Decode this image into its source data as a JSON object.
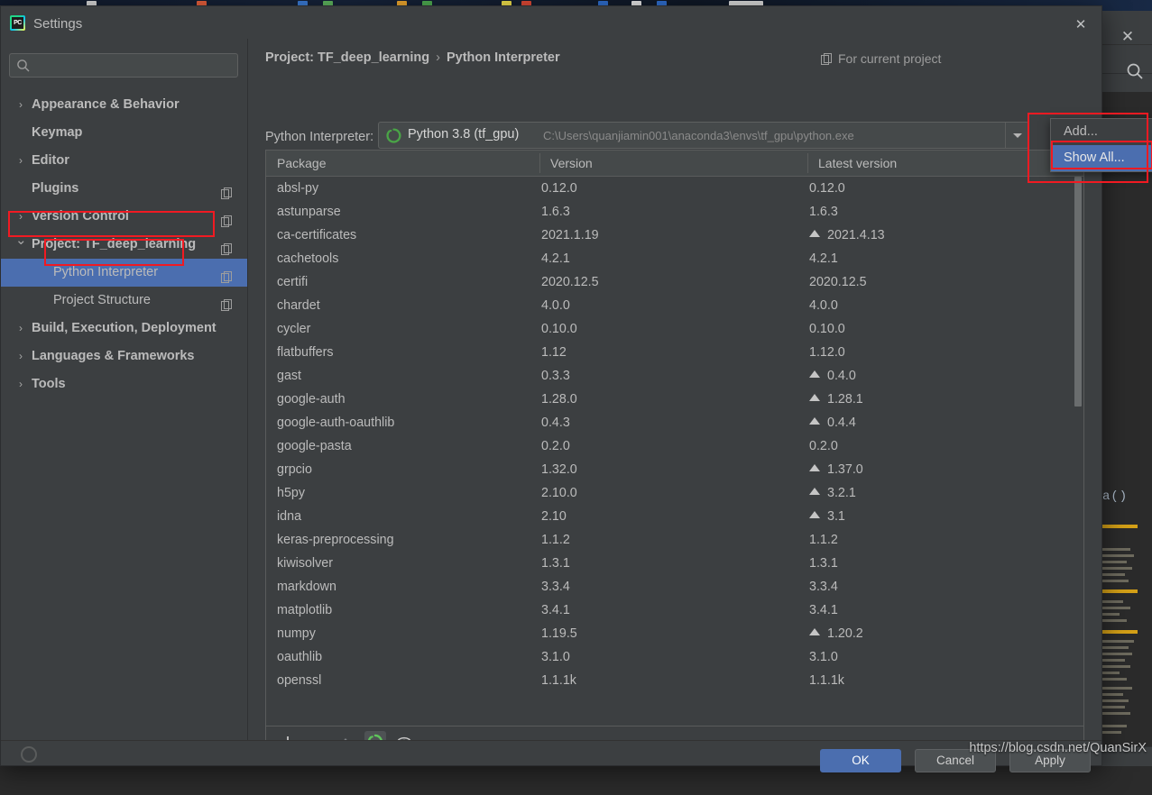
{
  "dialog": {
    "title": "Settings",
    "logo_text": "PC",
    "close_icon": "✕"
  },
  "search": {
    "value": "",
    "placeholder": "",
    "icon": "search-icon"
  },
  "sidebar": {
    "items": [
      {
        "label": "Appearance & Behavior",
        "level": 0,
        "twisty": "›",
        "copy": false,
        "selected": false
      },
      {
        "label": "Keymap",
        "level": 0,
        "twisty": "",
        "copy": false,
        "selected": false
      },
      {
        "label": "Editor",
        "level": 0,
        "twisty": "›",
        "copy": false,
        "selected": false
      },
      {
        "label": "Plugins",
        "level": 0,
        "twisty": "",
        "copy": true,
        "selected": false
      },
      {
        "label": "Version Control",
        "level": 0,
        "twisty": "›",
        "copy": true,
        "selected": false
      },
      {
        "label": "Project: TF_deep_learning",
        "level": 0,
        "twisty": "⌄",
        "copy": true,
        "selected": false
      },
      {
        "label": "Python Interpreter",
        "level": 1,
        "twisty": "",
        "copy": true,
        "selected": true
      },
      {
        "label": "Project Structure",
        "level": 1,
        "twisty": "",
        "copy": true,
        "selected": false
      },
      {
        "label": "Build, Execution, Deployment",
        "level": 0,
        "twisty": "›",
        "copy": false,
        "selected": false
      },
      {
        "label": "Languages & Frameworks",
        "level": 0,
        "twisty": "›",
        "copy": false,
        "selected": false
      },
      {
        "label": "Tools",
        "level": 0,
        "twisty": "›",
        "copy": false,
        "selected": false
      }
    ]
  },
  "content": {
    "breadcrumb_project": "Project: TF_deep_learning",
    "breadcrumb_separator": "›",
    "breadcrumb_page": "Python Interpreter",
    "for_current_project": "For current project",
    "interpreter_label": "Python Interpreter:",
    "interpreter_name": "Python 3.8 (tf_gpu)",
    "interpreter_path": "C:\\Users\\quanjiamin001\\anaconda3\\envs\\tf_gpu\\python.exe"
  },
  "popup": {
    "items": [
      {
        "label": "Add...",
        "highlighted": false
      },
      {
        "label": "Show All...",
        "highlighted": true
      }
    ]
  },
  "table": {
    "columns": [
      "Package",
      "Version",
      "Latest version"
    ],
    "rows": [
      {
        "package": "absl-py",
        "version": "0.12.0",
        "latest": "0.12.0",
        "upgradable": false
      },
      {
        "package": "astunparse",
        "version": "1.6.3",
        "latest": "1.6.3",
        "upgradable": false
      },
      {
        "package": "ca-certificates",
        "version": "2021.1.19",
        "latest": "2021.4.13",
        "upgradable": true
      },
      {
        "package": "cachetools",
        "version": "4.2.1",
        "latest": "4.2.1",
        "upgradable": false
      },
      {
        "package": "certifi",
        "version": "2020.12.5",
        "latest": "2020.12.5",
        "upgradable": false
      },
      {
        "package": "chardet",
        "version": "4.0.0",
        "latest": "4.0.0",
        "upgradable": false
      },
      {
        "package": "cycler",
        "version": "0.10.0",
        "latest": "0.10.0",
        "upgradable": false
      },
      {
        "package": "flatbuffers",
        "version": "1.12",
        "latest": "1.12.0",
        "upgradable": false
      },
      {
        "package": "gast",
        "version": "0.3.3",
        "latest": "0.4.0",
        "upgradable": true
      },
      {
        "package": "google-auth",
        "version": "1.28.0",
        "latest": "1.28.1",
        "upgradable": true
      },
      {
        "package": "google-auth-oauthlib",
        "version": "0.4.3",
        "latest": "0.4.4",
        "upgradable": true
      },
      {
        "package": "google-pasta",
        "version": "0.2.0",
        "latest": "0.2.0",
        "upgradable": false
      },
      {
        "package": "grpcio",
        "version": "1.32.0",
        "latest": "1.37.0",
        "upgradable": true
      },
      {
        "package": "h5py",
        "version": "2.10.0",
        "latest": "3.2.1",
        "upgradable": true
      },
      {
        "package": "idna",
        "version": "2.10",
        "latest": "3.1",
        "upgradable": true
      },
      {
        "package": "keras-preprocessing",
        "version": "1.1.2",
        "latest": "1.1.2",
        "upgradable": false
      },
      {
        "package": "kiwisolver",
        "version": "1.3.1",
        "latest": "1.3.1",
        "upgradable": false
      },
      {
        "package": "markdown",
        "version": "3.3.4",
        "latest": "3.3.4",
        "upgradable": false
      },
      {
        "package": "matplotlib",
        "version": "3.4.1",
        "latest": "3.4.1",
        "upgradable": false
      },
      {
        "package": "numpy",
        "version": "1.19.5",
        "latest": "1.20.2",
        "upgradable": true
      },
      {
        "package": "oauthlib",
        "version": "3.1.0",
        "latest": "3.1.0",
        "upgradable": false
      },
      {
        "package": "openssl",
        "version": "1.1.1k",
        "latest": "1.1.1k",
        "upgradable": false
      }
    ]
  },
  "toolbar": {
    "buttons": [
      "add-package-icon",
      "remove-package-icon",
      "upgrade-package-icon",
      "conda-env-icon",
      "show-early-releases-icon"
    ]
  },
  "footer": {
    "ok": "OK",
    "cancel": "Cancel",
    "apply": "Apply"
  },
  "watermark": "https://blog.csdn.net/QuanSirX",
  "background": {
    "code_fragment": "a()"
  },
  "colors": {
    "accent_blue": "#4b6eaf",
    "panel_bg": "#3c3f41",
    "editor_bg": "#2b2b2b",
    "text": "#bbbbbb",
    "annotation_red": "#f11a22",
    "python_green": "#4aa547"
  }
}
